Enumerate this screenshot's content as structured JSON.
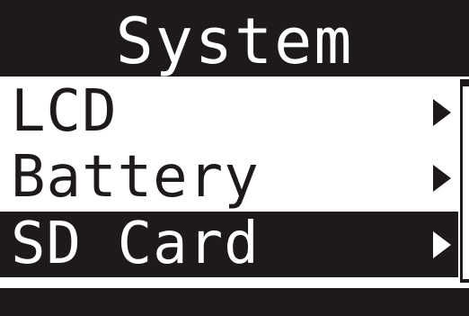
{
  "header": {
    "title": "System"
  },
  "menu": {
    "items": [
      {
        "label": "LCD",
        "selected": false,
        "icon": "right-triangle-icon"
      },
      {
        "label": "Battery",
        "selected": false,
        "icon": "right-triangle-icon"
      },
      {
        "label": "SD Card",
        "selected": true,
        "icon": "right-triangle-icon"
      }
    ]
  },
  "colors": {
    "background": "#ffffff",
    "foreground": "#1e1a1a",
    "highlight": "#1e1a1a",
    "highlight_text": "#ffffff"
  }
}
